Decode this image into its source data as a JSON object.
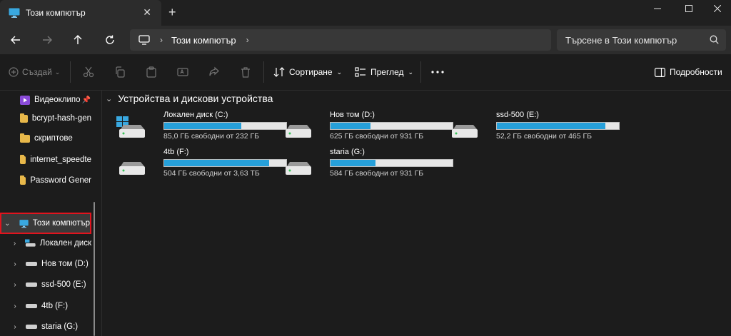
{
  "tab": {
    "title": "Този компютър"
  },
  "navbar": {
    "crumb": "Този компютър",
    "search_placeholder": "Търсене в Този компютър"
  },
  "toolbar": {
    "create_label": "Създай",
    "sort_label": "Сортиране",
    "view_label": "Преглед",
    "details_label": "Подробности"
  },
  "sidebar": {
    "quick": [
      {
        "label": "Видеоклипо",
        "icon": "video-folder-icon"
      },
      {
        "label": "bcrypt-hash-gen",
        "icon": "folder-icon"
      },
      {
        "label": "скриптове",
        "icon": "folder-icon"
      },
      {
        "label": "internet_speedte",
        "icon": "folder-icon"
      },
      {
        "label": "Password Gener",
        "icon": "folder-icon"
      }
    ],
    "this_pc": "Този компютър",
    "drives": [
      {
        "label": "Локален диск"
      },
      {
        "label": "Нов том (D:)"
      },
      {
        "label": "ssd-500 (E:)"
      },
      {
        "label": "4tb (F:)"
      },
      {
        "label": "staria (G:)"
      }
    ]
  },
  "content": {
    "group_title": "Устройства и дискови устройства",
    "drives": [
      {
        "name": "Локален диск (C:)",
        "free": "85,0 ГБ свободни от 232 ГБ",
        "used_fraction": 0.63,
        "system": true
      },
      {
        "name": "Нов том (D:)",
        "free": "625 ГБ свободни от 931 ГБ",
        "used_fraction": 0.33,
        "system": false
      },
      {
        "name": "ssd-500 (E:)",
        "free": "52,2 ГБ свободни от 465 ГБ",
        "used_fraction": 0.89,
        "system": false
      },
      {
        "name": "4tb (F:)",
        "free": "504 ГБ свободни от 3,63 ТБ",
        "used_fraction": 0.86,
        "system": false
      },
      {
        "name": "staria (G:)",
        "free": "584 ГБ свободни от 931 ГБ",
        "used_fraction": 0.37,
        "system": false
      }
    ]
  },
  "colors": {
    "accent": "#26a0da",
    "selection_outline": "#e0141e"
  }
}
